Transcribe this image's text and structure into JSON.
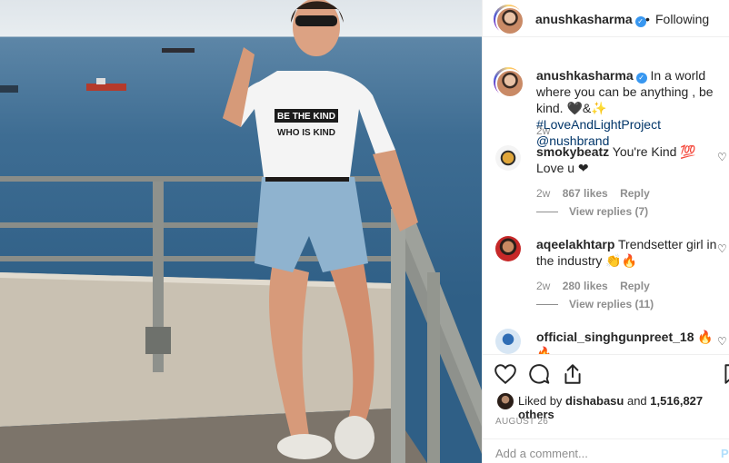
{
  "post": {
    "image_alt": "",
    "shirt_text_line1": "BE THE KIND",
    "shirt_text_line2": "WHO IS KIND"
  },
  "header": {
    "username": "anushkasharma",
    "separator": "•",
    "follow_status": "Following"
  },
  "caption": {
    "username": "anushkasharma",
    "text": "In a world where you can be anything , be kind. 🖤&✨",
    "hashtag": "#LoveAndLightProject",
    "mention": "@nushbrand",
    "timestamp": "2w"
  },
  "comments": [
    {
      "username": "smokybeatz",
      "text": "You're Kind 💯 Love u ❤",
      "timestamp": "2w",
      "likes": "867 likes",
      "reply": "Reply",
      "view_replies": "View replies (7)"
    },
    {
      "username": "aqeelakhtarp",
      "text": "Trendsetter girl in the industry 👏🔥",
      "timestamp": "2w",
      "likes": "280 likes",
      "reply": "Reply",
      "view_replies": "View replies (11)"
    },
    {
      "username": "official_singhgunpreet_18",
      "text": "🔥 🔥",
      "timestamp": ""
    }
  ],
  "actions": {
    "icons": [
      "heart-icon",
      "comment-icon",
      "share-icon",
      "bookmark-icon"
    ],
    "liked_by_prefix": "Liked by",
    "liked_by_user": "dishabasu",
    "liked_by_and": "and",
    "liked_by_count": "1,516,827 others",
    "date": "AUGUST 26"
  },
  "add_comment": {
    "placeholder": "Add a comment...",
    "post_label": "Post"
  },
  "colors": {
    "verified": "#3897f0",
    "link": "#003569",
    "muted": "#8e8e8e",
    "post_disabled": "#b2dffc"
  }
}
